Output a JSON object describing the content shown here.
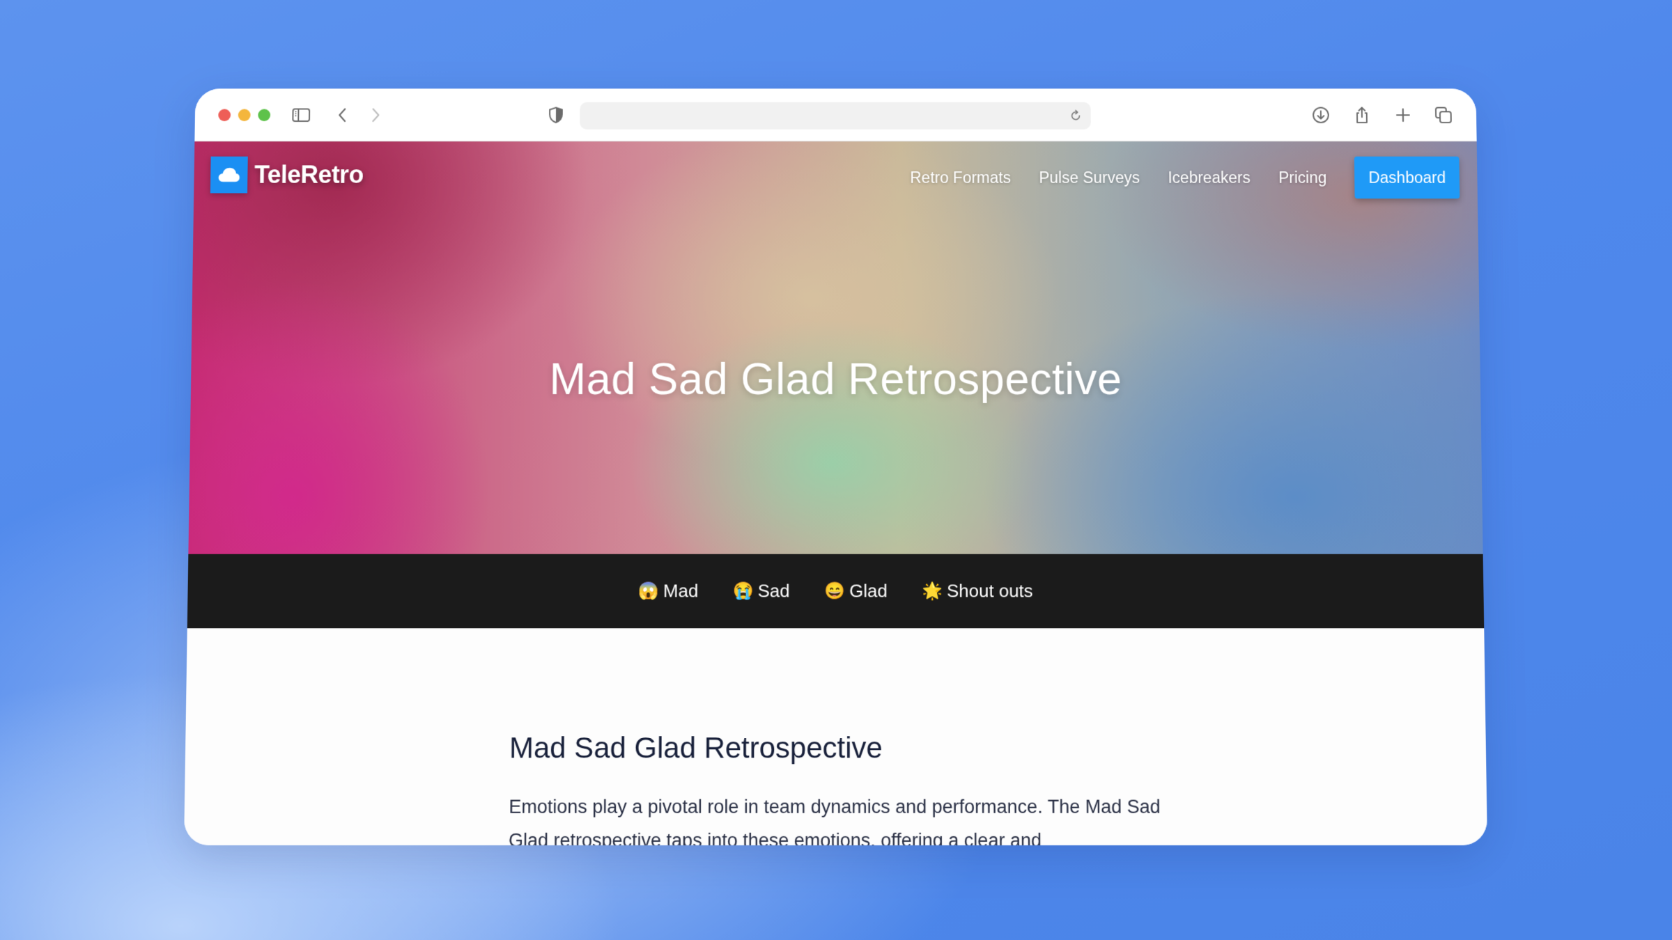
{
  "browser": {
    "address_value": "",
    "icons": [
      "sidebar-icon",
      "back-icon",
      "forward-icon",
      "privacy-shield-icon",
      "reload-icon",
      "download-icon",
      "share-icon",
      "new-tab-icon",
      "tab-overview-icon"
    ]
  },
  "site": {
    "brand": "TeleRetro",
    "brand_icon": "cloud-icon",
    "nav": [
      {
        "label": "Retro Formats"
      },
      {
        "label": "Pulse Surveys"
      },
      {
        "label": "Icebreakers"
      },
      {
        "label": "Pricing"
      }
    ],
    "cta_label": "Dashboard",
    "accent_color": "#1f9af7"
  },
  "hero": {
    "title": "Mad Sad Glad Retrospective"
  },
  "tabs": [
    {
      "emoji": "😱",
      "label": "Mad"
    },
    {
      "emoji": "😭",
      "label": "Sad"
    },
    {
      "emoji": "😄",
      "label": "Glad"
    },
    {
      "emoji": "🌟",
      "label": "Shout outs"
    }
  ],
  "content": {
    "heading": "Mad Sad Glad Retrospective",
    "paragraph": "Emotions play a pivotal role in team dynamics and performance. The Mad Sad Glad retrospective taps into these emotions, offering a clear and"
  }
}
